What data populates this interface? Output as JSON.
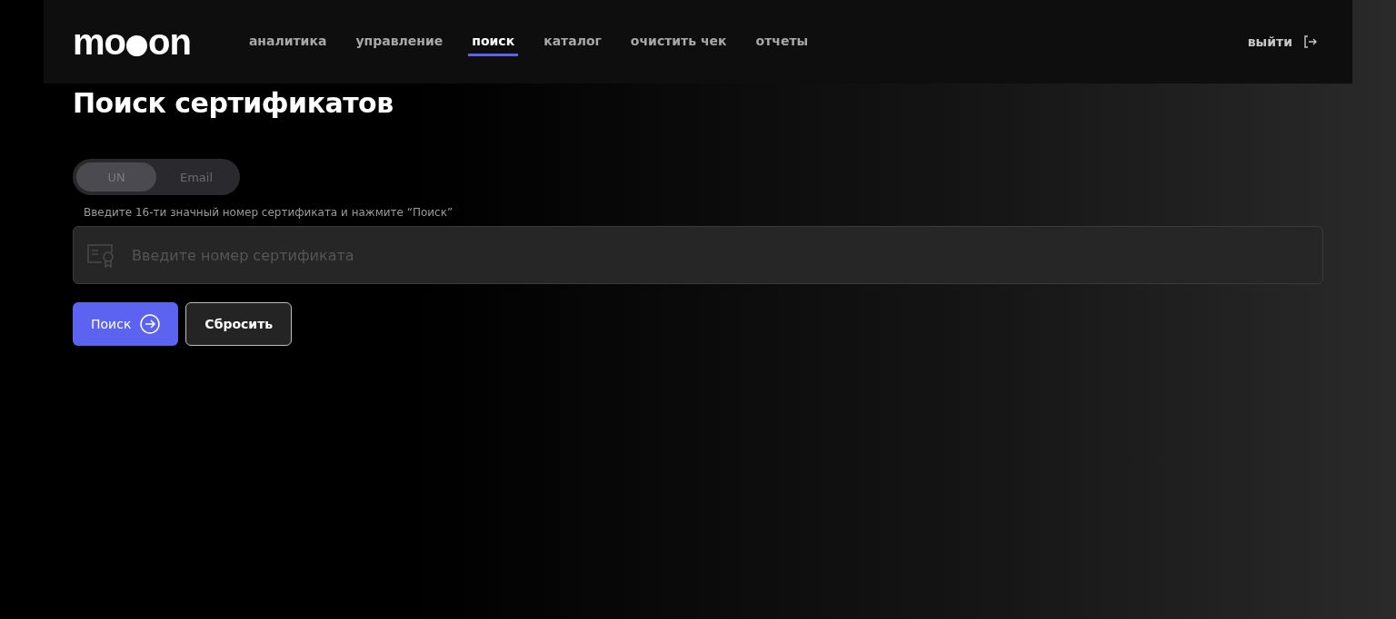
{
  "header": {
    "logo": {
      "before": "mo",
      "after": "on"
    },
    "nav": [
      {
        "label": "аналитика",
        "selected": false
      },
      {
        "label": "управление",
        "selected": false
      },
      {
        "label": "поиск",
        "selected": true
      },
      {
        "label": "каталог",
        "selected": false
      },
      {
        "label": "очистить чек",
        "selected": false
      },
      {
        "label": "отчеты",
        "selected": false
      }
    ],
    "logout": "выйти"
  },
  "title": "Поиск сертификатов",
  "mode_toggle": [
    {
      "label": "UN",
      "selected": true
    },
    {
      "label": "Email",
      "selected": false
    }
  ],
  "hint": "Введите 16-ти значный номер сертификата и нажмите “Поиск”",
  "search_field": {
    "placeholder": "Введите номер сертификата"
  },
  "buttons": [
    {
      "label": "Поиск",
      "kind": "primary"
    },
    {
      "label": "Сбросить",
      "kind": "secondary"
    }
  ]
}
